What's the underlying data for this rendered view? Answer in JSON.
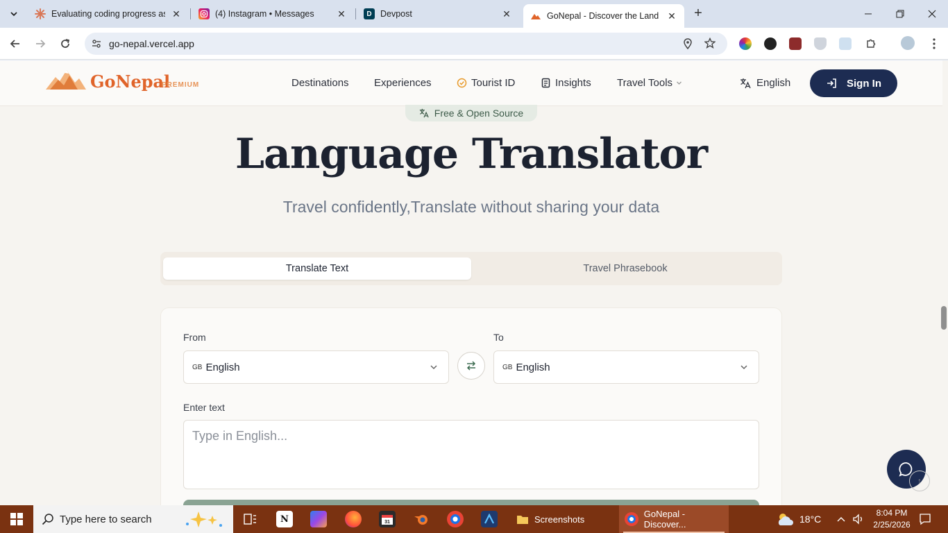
{
  "browser": {
    "tabs": [
      {
        "title": "Evaluating coding progress as a",
        "active": false
      },
      {
        "title": "(4) Instagram • Messages",
        "active": false
      },
      {
        "title": "Devpost",
        "active": false
      },
      {
        "title": "GoNepal - Discover the Land of",
        "active": true
      }
    ],
    "url": "go-nepal.vercel.app"
  },
  "site": {
    "logo_text": "GoNepal",
    "logo_badge": "PREMIUM",
    "nav": {
      "destinations": "Destinations",
      "experiences": "Experiences",
      "tourist_id": "Tourist ID",
      "insights": "Insights",
      "travel_tools": "Travel Tools"
    },
    "language": "English",
    "sign_in": "Sign In"
  },
  "hero": {
    "pill": "Free & Open Source",
    "title": "Language Translator",
    "subtitle": "Travel confidently,Translate without sharing your data"
  },
  "tabs": {
    "translate_text": "Translate Text",
    "phrasebook": "Travel Phrasebook"
  },
  "translator": {
    "from_label": "From",
    "to_label": "To",
    "from_flag": "GB",
    "from_value": "English",
    "to_flag": "GB",
    "to_value": "English",
    "input_label": "Enter text",
    "input_placeholder": "Type in English..."
  },
  "taskbar": {
    "search_placeholder": "Type here to search",
    "apps": [
      {
        "label": "Screenshots"
      },
      {
        "label": "GoNepal - Discover..."
      }
    ],
    "weather": "18°C",
    "time": "8:04 PM",
    "date": "2/25/2026"
  },
  "colors": {
    "brand_orange": "#e0642a",
    "navy": "#1d2c52",
    "taskbar": "#7a3211"
  }
}
